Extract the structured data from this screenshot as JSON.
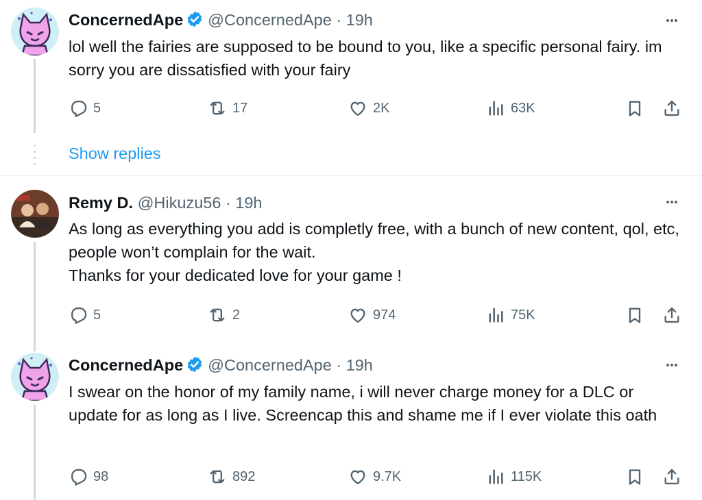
{
  "tweets": [
    {
      "name": "ConcernedApe",
      "verified": true,
      "handle": "@ConcernedApe",
      "dot": "·",
      "time": "19h",
      "text": "lol well the fairies are supposed to be bound to you, like a specific personal fairy. im sorry you are dissatisfied with your fairy",
      "replies": "5",
      "retweets": "17",
      "likes": "2K",
      "views": "63K",
      "avatar": "pink-cat-avatar"
    },
    {
      "name": "Remy D.",
      "verified": false,
      "handle": "@Hikuzu56",
      "dot": "·",
      "time": "19h",
      "text": "As long as everything you add is completly free, with a bunch of new content, qol, etc, people won’t complain for the wait.\nThanks for your dedicated love for your game !",
      "replies": "5",
      "retweets": "2",
      "likes": "974",
      "views": "75K",
      "avatar": "photo-avatar"
    },
    {
      "name": "ConcernedApe",
      "verified": true,
      "handle": "@ConcernedApe",
      "dot": "·",
      "time": "19h",
      "text": "I swear on the honor of my family name,  i will never charge money for a DLC or update for as long as I live. Screencap this and shame me if I ever violate this oath",
      "replies": "98",
      "retweets": "892",
      "likes": "9.7K",
      "views": "115K",
      "avatar": "pink-cat-avatar"
    }
  ],
  "show_replies": "Show replies",
  "colors": {
    "accent": "#1d9bf0",
    "secondary_text": "#536471",
    "primary_text": "#0f1419",
    "thread_line": "#cfd9de"
  }
}
